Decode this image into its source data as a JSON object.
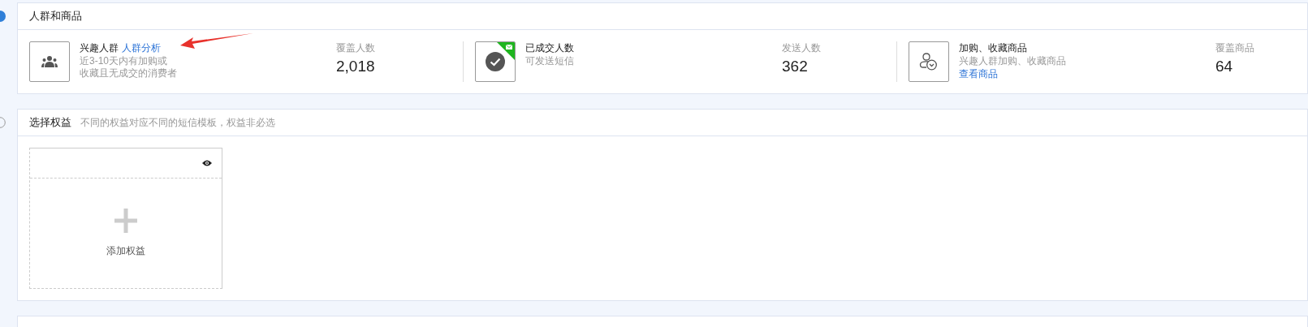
{
  "steps": [
    {
      "title": "人群和商品",
      "groups": [
        {
          "kind": "people",
          "title": "兴趣人群",
          "link": "人群分析",
          "desc": [
            "近3-10天内有加购或",
            "收藏且无成交的消费者"
          ],
          "stat_label": "覆盖人数",
          "stat_value": "2,018",
          "badge": false
        },
        {
          "kind": "check",
          "title": "已成交人数",
          "desc": [
            "可发送短信"
          ],
          "stat_label": "发送人数",
          "stat_value": "362",
          "badge": true
        },
        {
          "kind": "cart",
          "title": "加购、收藏商品",
          "desc": [
            "兴趣人群加购、收藏商品"
          ],
          "extra_link": "查看商品",
          "stat_label": "覆盖商品",
          "stat_value": "64",
          "badge": false
        }
      ]
    },
    {
      "title": "选择权益",
      "hint": "不同的权益对应不同的短信模板，权益非必选",
      "add_label": "添加权益"
    }
  ]
}
